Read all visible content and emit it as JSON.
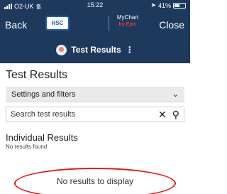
{
  "status_bar": {
    "carrier": "O2-UK",
    "time": "15:22",
    "battery": "41%"
  },
  "nav": {
    "back_label": "Back",
    "close_label": "Close",
    "hsc_logo_text": "HSC",
    "mychart_text": "MyChart",
    "mychart_sub": "by Epic"
  },
  "title_bar": {
    "label": "Test Results",
    "menu_glyph": "⋮"
  },
  "main": {
    "page_title": "Test Results",
    "settings_label": "Settings and filters",
    "search": {
      "value": "",
      "placeholder": "Search test results"
    },
    "individual_title": "Individual Results",
    "individual_sub": "No results found",
    "empty_message": "No results to display"
  },
  "colors": {
    "header_bg": "#1d3a5c",
    "highlight_ring": "#e31b1b",
    "hsc_blue": "#1f5fa8"
  }
}
